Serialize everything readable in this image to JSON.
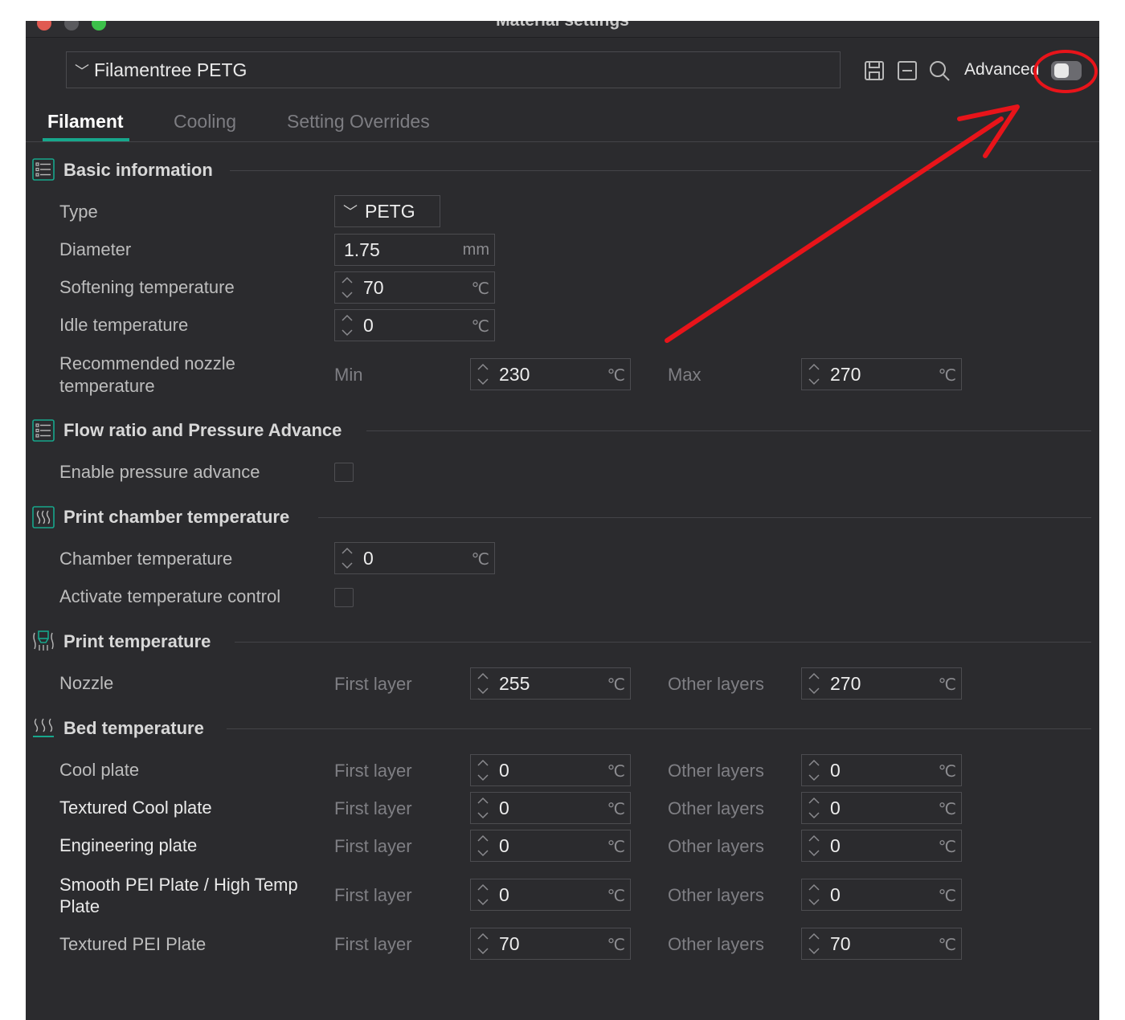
{
  "window": {
    "title": "Material settings"
  },
  "header": {
    "preset_name": "Filamentree PETG",
    "advanced_label": "Advanced",
    "advanced_enabled": false,
    "icons": [
      "save-icon",
      "collapse-icon",
      "search-icon"
    ]
  },
  "tabs": [
    {
      "label": "Filament",
      "active": true
    },
    {
      "label": "Cooling",
      "active": false
    },
    {
      "label": "Setting Overrides",
      "active": false
    }
  ],
  "sections": {
    "basic": {
      "title": "Basic information",
      "type_label": "Type",
      "type_value": "PETG",
      "diameter_label": "Diameter",
      "diameter_value": "1.75",
      "diameter_unit": "mm",
      "softening_label": "Softening temperature",
      "softening_value": "70",
      "idle_label": "Idle temperature",
      "idle_value": "0",
      "nozzle_rec_label": "Recommended nozzle temperature",
      "min_label": "Min",
      "min_value": "230",
      "max_label": "Max",
      "max_value": "270"
    },
    "flow": {
      "title": "Flow ratio and Pressure Advance",
      "pa_label": "Enable pressure advance",
      "pa_checked": false
    },
    "chamber": {
      "title": "Print chamber temperature",
      "chamber_label": "Chamber temperature",
      "chamber_value": "0",
      "control_label": "Activate temperature control",
      "control_checked": false
    },
    "print_temp": {
      "title": "Print temperature",
      "nozzle_label": "Nozzle",
      "first_label": "First layer",
      "first_value": "255",
      "other_label": "Other layers",
      "other_value": "270"
    },
    "bed": {
      "title": "Bed temperature",
      "first_label": "First layer",
      "other_label": "Other layers",
      "plates": [
        {
          "name": "Cool plate",
          "first": "0",
          "other": "0"
        },
        {
          "name": "Textured Cool plate",
          "first": "0",
          "other": "0"
        },
        {
          "name": "Engineering plate",
          "first": "0",
          "other": "0"
        },
        {
          "name": "Smooth PEI Plate / High Temp Plate",
          "first": "0",
          "other": "0"
        },
        {
          "name": "Textured PEI Plate",
          "first": "70",
          "other": "70"
        }
      ]
    }
  },
  "temp_unit": "℃",
  "colors": {
    "accent": "#17a78c",
    "annotation": "#e8141a",
    "background": "#2b2b2e"
  }
}
